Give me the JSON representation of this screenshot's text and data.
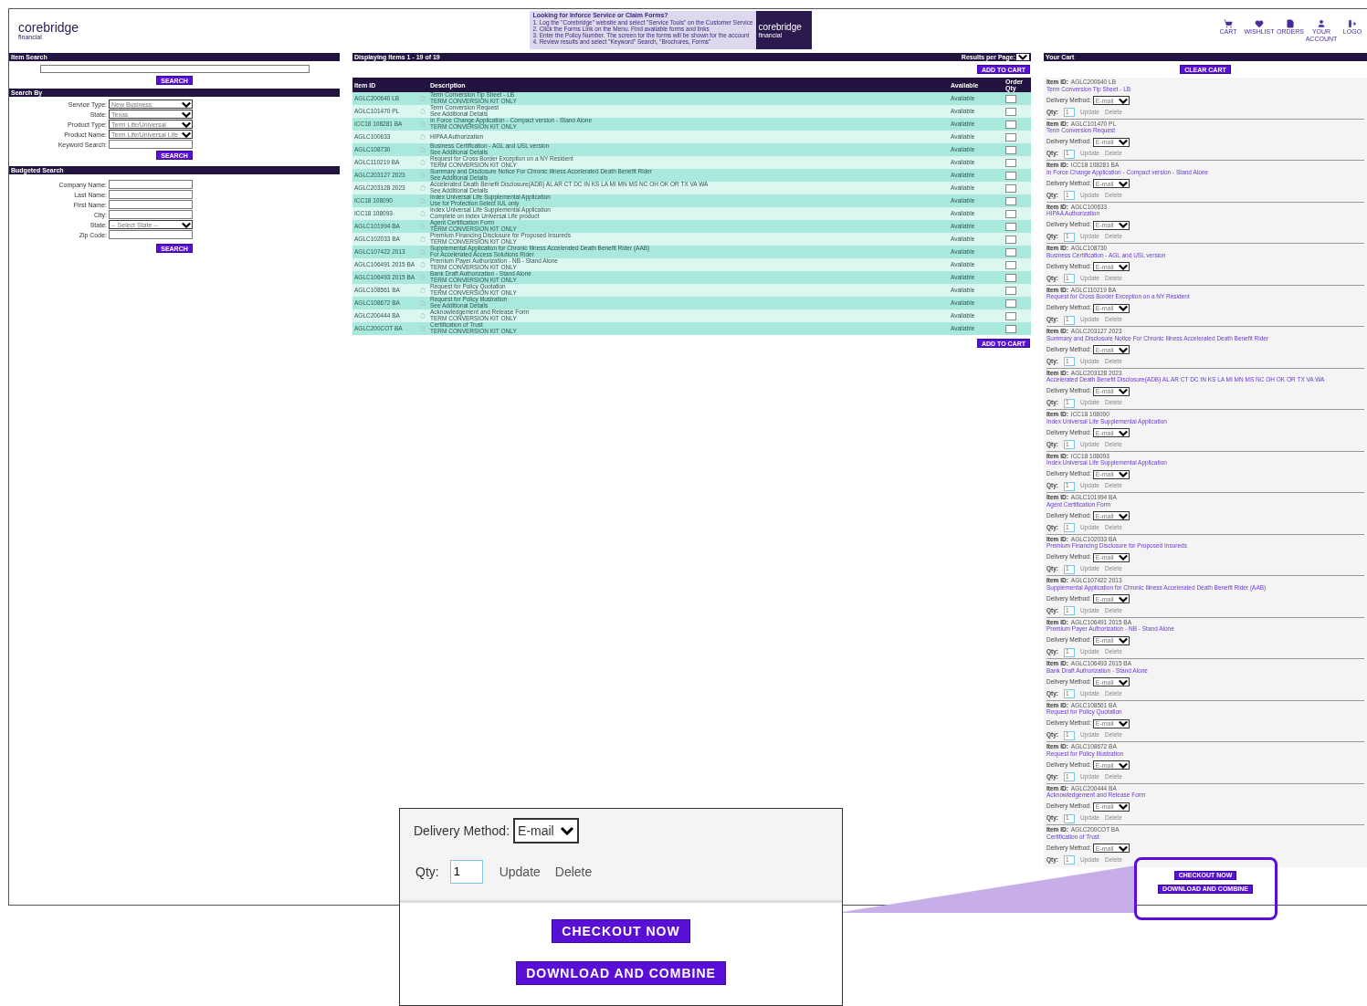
{
  "header": {
    "logo": {
      "name": "corebridge",
      "sub": "financial"
    },
    "banner": {
      "title": "Looking for Inforce Service or Claim Forms?",
      "lines": [
        "1. Log the \"Corebridge\" website and select \"Service Tools\" on the Customer Service",
        "2. Click the Forms Link on the Menu. Find available forms and links",
        "3. Enter the Policy Number. The screen for the forms will be shown for the account",
        "4. Review results and select \"Keyword\" Search, \"Brochures, Forms\""
      ],
      "logo": "corebridge",
      "logo_sub": "financial"
    },
    "nav": [
      {
        "label": "CART",
        "kind": "cart"
      },
      {
        "label": "WISHLIST",
        "kind": "wishlist"
      },
      {
        "label": "ORDERS",
        "kind": "orders"
      },
      {
        "label": "YOUR ACCOUNT",
        "kind": "account"
      },
      {
        "label": "LOGO",
        "kind": "logout"
      }
    ]
  },
  "search_panel": {
    "item_search": {
      "title": "Item Search",
      "button": "SEARCH"
    },
    "search_by": {
      "title": "Search By",
      "fields": [
        {
          "label": "Service Type:",
          "kind": "select",
          "value": "New Business"
        },
        {
          "label": "State:",
          "kind": "select",
          "value": "Texas"
        },
        {
          "label": "Product Type:",
          "kind": "select",
          "value": "Term Life/Universal"
        },
        {
          "label": "Product Name:",
          "kind": "select",
          "value": "Term Life/Universal Life"
        },
        {
          "label": "Keyword Search:",
          "kind": "input"
        }
      ],
      "button": "SEARCH"
    },
    "budget_search": {
      "title": "Budgeted Search",
      "fields": [
        {
          "label": "Company Name:",
          "kind": "input"
        },
        {
          "label": "Last Name:",
          "kind": "input"
        },
        {
          "label": "First Name:",
          "kind": "input"
        },
        {
          "label": "City:",
          "kind": "input"
        },
        {
          "label": "State:",
          "kind": "select",
          "value": "-- Select State --"
        },
        {
          "label": "Zip Code:",
          "kind": "input"
        }
      ],
      "button": "SEARCH"
    }
  },
  "results": {
    "displaying": "Displaying Items 1 - 19 of 19",
    "results_per_page": "Results per Page:",
    "add_to_cart_top": "ADD TO CART",
    "add_to_cart_bottom": "ADD TO CART",
    "columns": [
      "Item ID",
      "Description",
      "Available",
      "Order Qty"
    ],
    "rows": [
      {
        "id": "AGLC200640 LB",
        "title": "Term Conversion Tip Sheet - LB",
        "note": "TERM CONVERSION KIT ONLY",
        "available": "Available"
      },
      {
        "id": "AGLC101470 PL",
        "title": "Term Conversion Request",
        "note": "See Additional Details",
        "available": "Available"
      },
      {
        "id": "ICC18 108281 BA",
        "title": "In Force Change Application - Compact version - Stand Alone",
        "note": "TERM CONVERSION KIT ONLY",
        "available": "Available"
      },
      {
        "id": "AGLC100633",
        "title": "HIPAA Authorization",
        "available": "Available"
      },
      {
        "id": "AGLC108730",
        "title": "Business Certification - AGL and USL version",
        "note": "See Additional Details",
        "available": "Available"
      },
      {
        "id": "AGLC110219 BA",
        "title": "Request for Cross Border Exception on a NY Resident",
        "note": "TERM CONVERSION KIT ONLY",
        "available": "Available"
      },
      {
        "id": "AGLC203127 2023",
        "title": "Summary and Disclosure Notice For Chronic Illness Accelerated Death Benefit Rider",
        "note": "See Additional Details",
        "available": "Available"
      },
      {
        "id": "AGLC203128 2023",
        "title": "Accelerated Death Benefit Disclosure(ADB) AL AR CT DC IN KS LA MI MN MS NC OH OK OR TX VA WA",
        "note": "See Additional Details",
        "available": "Available"
      },
      {
        "id": "ICC18 108090",
        "title": "Index Universal Life Supplemental Application",
        "note": "Use for Protection Select IUL only",
        "available": "Available"
      },
      {
        "id": "ICC18 108093",
        "title": "Index Universal Life Supplemental Application",
        "note": "Complete on Index Universal Life product",
        "available": "Available"
      },
      {
        "id": "AGLC101994 BA",
        "title": "Agent Certification Form",
        "note": "TERM CONVERSION KIT ONLY",
        "available": "Available"
      },
      {
        "id": "AGLC102033 BA",
        "title": "Premium Financing Disclosure for Proposed Insureds",
        "note": "TERM CONVERSION KIT ONLY",
        "available": "Available"
      },
      {
        "id": "AGLC107422 2013",
        "title": "Supplemental Application for Chronic Illness Accelerated Death Benefit Rider (AAB)",
        "note": "For Accelerated Access Solutions Rider",
        "available": "Available"
      },
      {
        "id": "AGLC106491 2015 BA",
        "title": "Premium Payer Authorization - NB - Stand Alone",
        "note": "TERM CONVERSION KIT ONLY",
        "available": "Available"
      },
      {
        "id": "AGLC106493 2015 BA",
        "title": "Bank Draft Authorization - Stand Alone",
        "note": "TERM CONVERSION KIT ONLY",
        "available": "Available"
      },
      {
        "id": "AGLC108561 BA",
        "title": "Request for Policy Quotation",
        "note": "TERM CONVERSION KIT ONLY",
        "available": "Available"
      },
      {
        "id": "AGLC108672 BA",
        "title": "Request for Policy Illustration",
        "note": "See Additional Details",
        "available": "Available"
      },
      {
        "id": "AGLC200444 BA",
        "title": "Acknowledgement and Release Form",
        "note": "TERM CONVERSION KIT ONLY",
        "available": "Available"
      },
      {
        "id": "AGLC200COT BA",
        "title": "Certification of Trust",
        "note": "TERM CONVERSION KIT ONLY",
        "available": "Available"
      }
    ]
  },
  "cart": {
    "title": "Your Cart",
    "clear": "CLEAR CART",
    "items": [
      {
        "item_label": "Item ID:",
        "id": "AGLC200640 LB",
        "title": "Term Conversion Tip Sheet - LB",
        "delivery_label": "Delivery Method:",
        "method": "E-mail",
        "qty_label": "Qty:",
        "qty": "1",
        "update": "Update",
        "delete": "Delete"
      },
      {
        "item_label": "Item ID:",
        "id": "AGLC101470 PL",
        "title": "Term Conversion Request",
        "delivery_label": "Delivery Method:",
        "method": "E-mail",
        "qty_label": "Qty:",
        "qty": "1",
        "update": "Update",
        "delete": "Delete"
      },
      {
        "item_label": "Item ID:",
        "id": "ICC18 108281 BA",
        "title": "In Force Change Application - Compact version - Stand Alone",
        "delivery_label": "Delivery Method:",
        "method": "E-mail",
        "qty_label": "Qty:",
        "qty": "1",
        "update": "Update",
        "delete": "Delete"
      },
      {
        "item_label": "Item ID:",
        "id": "AGLC100633",
        "title": "HIPAA Authorization",
        "delivery_label": "Delivery Method:",
        "method": "E-mail",
        "qty_label": "Qty:",
        "qty": "1",
        "update": "Update",
        "delete": "Delete"
      },
      {
        "item_label": "Item ID:",
        "id": "AGLC108730",
        "title": "Business Certification - AGL and USL version",
        "delivery_label": "Delivery Method:",
        "method": "E-mail",
        "qty_label": "Qty:",
        "qty": "1",
        "update": "Update",
        "delete": "Delete"
      },
      {
        "item_label": "Item ID:",
        "id": "AGLC110219 BA",
        "title": "Request for Cross Border Exception on a NY Resident",
        "delivery_label": "Delivery Method:",
        "method": "E-mail",
        "qty_label": "Qty:",
        "qty": "1",
        "update": "Update",
        "delete": "Delete"
      },
      {
        "item_label": "Item ID:",
        "id": "AGLC203127 2023",
        "title": "Summary and Disclosure Notice For Chronic Illness Accelerated Death Benefit Rider",
        "delivery_label": "Delivery Method:",
        "method": "E-mail",
        "qty_label": "Qty:",
        "qty": "1",
        "update": "Update",
        "delete": "Delete"
      },
      {
        "item_label": "Item ID:",
        "id": "AGLC203128 2023",
        "title": "Accelerated Death Benefit Disclosure(ADB) AL AR CT DC IN KS LA MI MN MS NC OH OK OR TX VA WA",
        "delivery_label": "Delivery Method:",
        "method": "E-mail",
        "qty_label": "Qty:",
        "qty": "1",
        "update": "Update",
        "delete": "Delete"
      },
      {
        "item_label": "Item ID:",
        "id": "ICC18 108090",
        "title": "Index Universal Life Supplemental Application",
        "delivery_label": "Delivery Method:",
        "method": "E-mail",
        "qty_label": "Qty:",
        "qty": "1",
        "update": "Update",
        "delete": "Delete"
      },
      {
        "item_label": "Item ID:",
        "id": "ICC18 108093",
        "title": "Index Universal Life Supplemental Application",
        "delivery_label": "Delivery Method:",
        "method": "E-mail",
        "qty_label": "Qty:",
        "qty": "1",
        "update": "Update",
        "delete": "Delete"
      },
      {
        "item_label": "Item ID:",
        "id": "AGLC101994 BA",
        "title": "Agent Certification Form",
        "delivery_label": "Delivery Method:",
        "method": "E-mail",
        "qty_label": "Qty:",
        "qty": "1",
        "update": "Update",
        "delete": "Delete"
      },
      {
        "item_label": "Item ID:",
        "id": "AGLC102033 BA",
        "title": "Premium Financing Disclosure for Proposed Insureds",
        "delivery_label": "Delivery Method:",
        "method": "E-mail",
        "qty_label": "Qty:",
        "qty": "1",
        "update": "Update",
        "delete": "Delete"
      },
      {
        "item_label": "Item ID:",
        "id": "AGLC107422 2013",
        "title": "Supplemental Application for Chronic Illness Accelerated Death Benefit Rider (AAB)",
        "delivery_label": "Delivery Method:",
        "method": "E-mail",
        "qty_label": "Qty:",
        "qty": "1",
        "update": "Update",
        "delete": "Delete"
      },
      {
        "item_label": "Item ID:",
        "id": "AGLC106491 2015 BA",
        "title": "Premium Payer Authorization - NB - Stand Alone",
        "delivery_label": "Delivery Method:",
        "method": "E-mail",
        "qty_label": "Qty:",
        "qty": "1",
        "update": "Update",
        "delete": "Delete"
      },
      {
        "item_label": "Item ID:",
        "id": "AGLC106493 2015 BA",
        "title": "Bank Draft Authorization - Stand Alone",
        "delivery_label": "Delivery Method:",
        "method": "E-mail",
        "qty_label": "Qty:",
        "qty": "1",
        "update": "Update",
        "delete": "Delete"
      },
      {
        "item_label": "Item ID:",
        "id": "AGLC108561 BA",
        "title": "Request for Policy Quotation",
        "delivery_label": "Delivery Method:",
        "method": "E-mail",
        "qty_label": "Qty:",
        "qty": "1",
        "update": "Update",
        "delete": "Delete"
      },
      {
        "item_label": "Item ID:",
        "id": "AGLC108672 BA",
        "title": "Request for Policy Illustration",
        "delivery_label": "Delivery Method:",
        "method": "E-mail",
        "qty_label": "Qty:",
        "qty": "1",
        "update": "Update",
        "delete": "Delete"
      },
      {
        "item_label": "Item ID:",
        "id": "AGLC200444 BA",
        "title": "Acknowledgement and Release Form",
        "delivery_label": "Delivery Method:",
        "method": "E-mail",
        "qty_label": "Qty:",
        "qty": "1",
        "update": "Update",
        "delete": "Delete"
      },
      {
        "item_label": "Item ID:",
        "id": "AGLC200COT BA",
        "title": "Certification of Trust",
        "delivery_label": "Delivery Method:",
        "method": "E-mail",
        "qty_label": "Qty:",
        "qty": "1",
        "update": "Update",
        "delete": "Delete"
      }
    ],
    "checkout": "CHECKOUT NOW",
    "download": "DOWNLOAD AND COMBINE"
  },
  "callout": {
    "delivery_label": "Delivery Method:",
    "method": "E-mail",
    "qty_label": "Qty:",
    "qty": "1",
    "update": "Update",
    "delete": "Delete",
    "checkout": "CHECKOUT NOW",
    "download": "DOWNLOAD AND COMBINE"
  }
}
